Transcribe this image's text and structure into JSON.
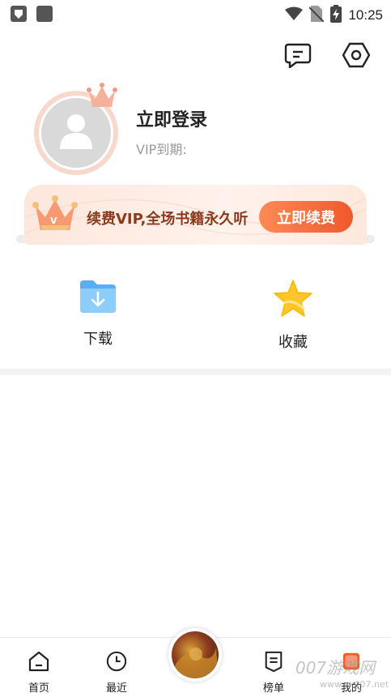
{
  "status_bar": {
    "time": "10:25",
    "icons": [
      "shield-notification-icon",
      "app-notification-icon",
      "wifi-icon",
      "no-sim-icon",
      "battery-charging-icon"
    ]
  },
  "header": {
    "icons": [
      "message-icon",
      "settings-icon"
    ]
  },
  "profile": {
    "login_label": "立即登录",
    "vip_expire_label": "VIP到期:"
  },
  "vip_banner": {
    "text": "续费VIP,全场书籍永久听",
    "button_label": "立即续费",
    "colors": {
      "button_start": "#ff8a55",
      "button_end": "#f0592b",
      "text": "#8a3b1d"
    }
  },
  "shortcuts": [
    {
      "label": "下载",
      "icon": "download-folder-icon"
    },
    {
      "label": "收藏",
      "icon": "star-icon"
    }
  ],
  "bottom_nav": [
    {
      "label": "首页",
      "icon": "home-icon"
    },
    {
      "label": "最近",
      "icon": "clock-icon"
    },
    {
      "label": "",
      "icon": "now-playing-cover"
    },
    {
      "label": "榜单",
      "icon": "ranking-icon"
    },
    {
      "label": "我的",
      "icon": "profile-icon"
    }
  ],
  "watermark": {
    "text": "007游戏网",
    "sub": "www.yx007.net"
  }
}
